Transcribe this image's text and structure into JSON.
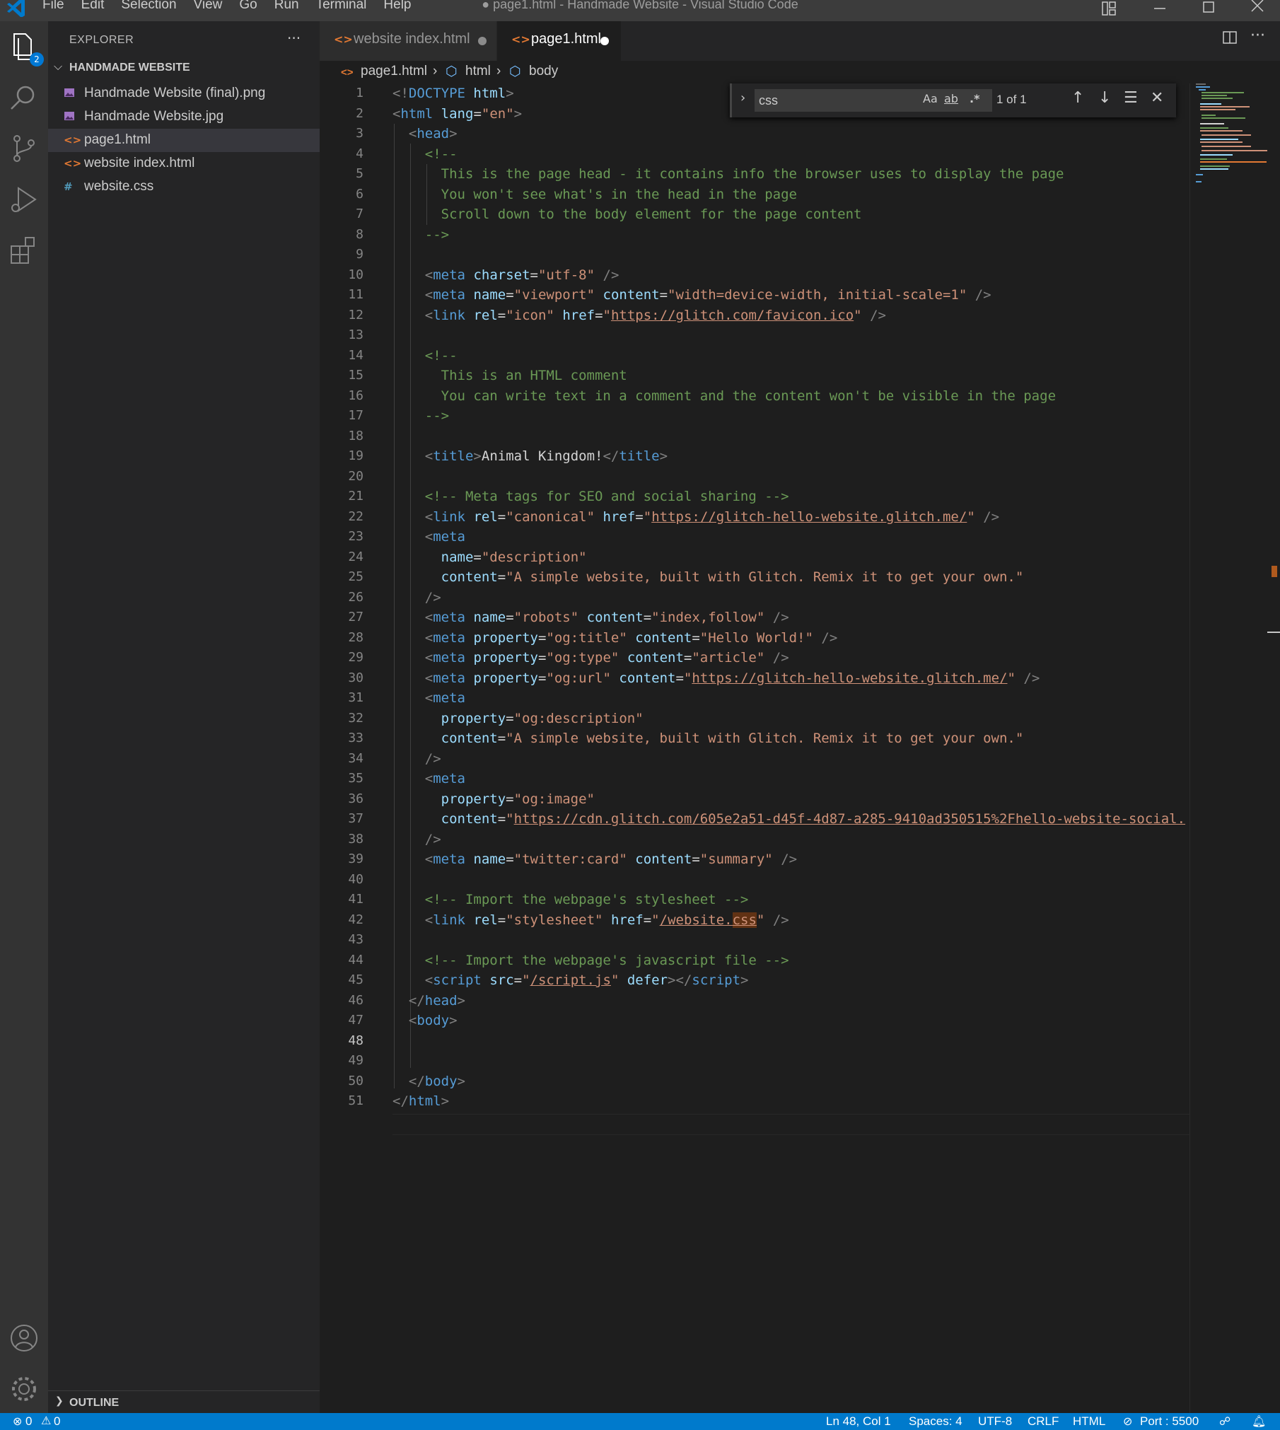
{
  "window": {
    "title": "● page1.html - Handmade Website - Visual Studio Code",
    "menu": [
      "File",
      "Edit",
      "Selection",
      "View",
      "Go",
      "Run",
      "Terminal",
      "Help"
    ]
  },
  "activity_bar": {
    "explorer_badge": "2",
    "items": [
      "explorer-icon",
      "search-icon",
      "source-control-icon",
      "run-debug-icon",
      "extensions-icon"
    ],
    "bottom": [
      "account-icon",
      "gear-icon"
    ]
  },
  "sidebar": {
    "title": "EXPLORER",
    "more": "···",
    "folder": "HANDMADE WEBSITE",
    "files": [
      {
        "name": "Handmade Website (final).png",
        "icon": "image",
        "color": "#a074c4"
      },
      {
        "name": "Handmade Website.jpg",
        "icon": "image",
        "color": "#a074c4"
      },
      {
        "name": "page1.html",
        "icon": "<>",
        "color": "#e37933"
      },
      {
        "name": "website index.html",
        "icon": "<>",
        "color": "#e37933"
      },
      {
        "name": "website.css",
        "icon": "#",
        "color": "#519aba"
      }
    ],
    "outline": "OUTLINE"
  },
  "tabs": [
    {
      "label": "website index.html",
      "active": false
    },
    {
      "label": "page1.html",
      "active": true
    }
  ],
  "breadcrumb": {
    "file": "page1.html",
    "html": "html",
    "body": "body"
  },
  "find": {
    "query": "css",
    "match_case": "Aa",
    "whole_word": "ab",
    "regex": ".*",
    "count": "1 of 1"
  },
  "status": {
    "errors": "0",
    "warnings": "0",
    "position": "Ln 48, Col 1",
    "spaces": "Spaces: 4",
    "encoding": "UTF-8",
    "eol": "CRLF",
    "language": "HTML",
    "port": "Port : 5500"
  },
  "editor": {
    "current_line": "48",
    "lines": [
      "1",
      "2",
      "3",
      "4",
      "5",
      "6",
      "7",
      "8",
      "9",
      "10",
      "11",
      "12",
      "13",
      "14",
      "15",
      "16",
      "17",
      "18",
      "19",
      "20",
      "21",
      "22",
      "23",
      "24",
      "25",
      "26",
      "27",
      "28",
      "29",
      "30",
      "31",
      "32",
      "33",
      "34",
      "35",
      "36",
      "37",
      "38",
      "39",
      "40",
      "41",
      "42",
      "43",
      "44",
      "45",
      "46",
      "47",
      "48",
      "49",
      "50",
      "51"
    ],
    "comment_head": [
      "This is the page head - it contains info the browser uses to display the page",
      "You won't see what's in the head in the page",
      "Scroll down to the body element for the page content"
    ],
    "comment_html": [
      "This is an HTML comment",
      "You can write text in a comment and the content won't be visible in the page"
    ],
    "title_text": "Animal Kingdom!",
    "seo_comment": "<!-- Meta tags for SEO and social sharing -->",
    "canonical_url": "https://glitch-hello-website.glitch.me/",
    "description": "\"A simple website, built with Glitch. Remix it to get your own.\"",
    "og_image_url": "https://cdn.glitch.com/605e2a51-d45f-4d87-a285-9410ad350515%2Fhello-website-social.",
    "stylesheet_comment": "<!-- Import the webpage's stylesheet -->",
    "script_comment": "<!-- Import the webpage's javascript file -->"
  }
}
